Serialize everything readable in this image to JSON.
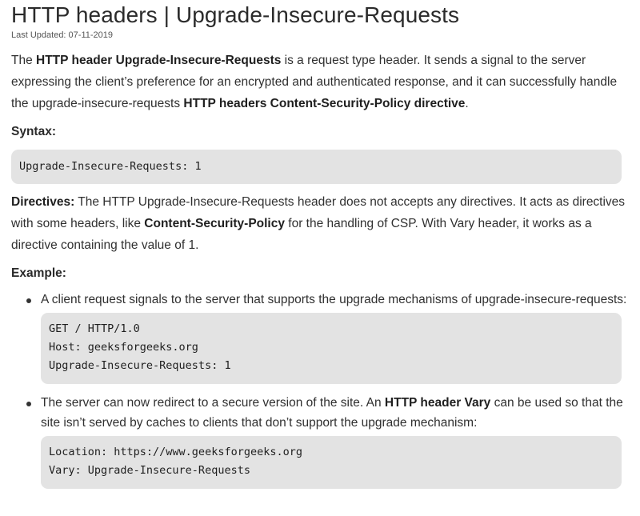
{
  "article": {
    "title": "HTTP headers | Upgrade-Insecure-Requests",
    "last_updated": "Last Updated: 07-11-2019"
  },
  "intro": {
    "t1": "The ",
    "b1": "HTTP header Upgrade-Insecure-Requests",
    "t2": " is a request type header. It sends a signal to the server expressing the client’s preference for an encrypted and authenticated response, and it can successfully handle the upgrade-insecure-requests ",
    "b2": "HTTP headers Content-Security-Policy directive",
    "t3": "."
  },
  "syntax": {
    "heading": "Syntax:",
    "code": "Upgrade-Insecure-Requests: 1"
  },
  "directives": {
    "label": "Directives:",
    "t1": " The HTTP Upgrade-Insecure-Requests header does not accepts any directives. It acts as directives with some headers, like ",
    "b1": "Content-Security-Policy",
    "t2": " for the handling of CSP. With Vary header, it works as a directive containing the value of 1."
  },
  "example": {
    "heading": "Example:",
    "items": [
      {
        "t1": "A client request signals to the server that supports the upgrade mechanisms of upgrade-insecure-requests:",
        "code": [
          "GET / HTTP/1.0",
          "Host: geeksforgeeks.org",
          "Upgrade-Insecure-Requests: 1"
        ]
      },
      {
        "t1": "The server can now redirect to a secure version of the site. An ",
        "b1": "HTTP header Vary",
        "t2": " can be used so that the site isn’t served by caches to clients that don’t support the upgrade mechanism:",
        "code": [
          "Location: https://www.geeksforgeeks.org",
          "Vary: Upgrade-Insecure-Requests"
        ]
      }
    ]
  }
}
